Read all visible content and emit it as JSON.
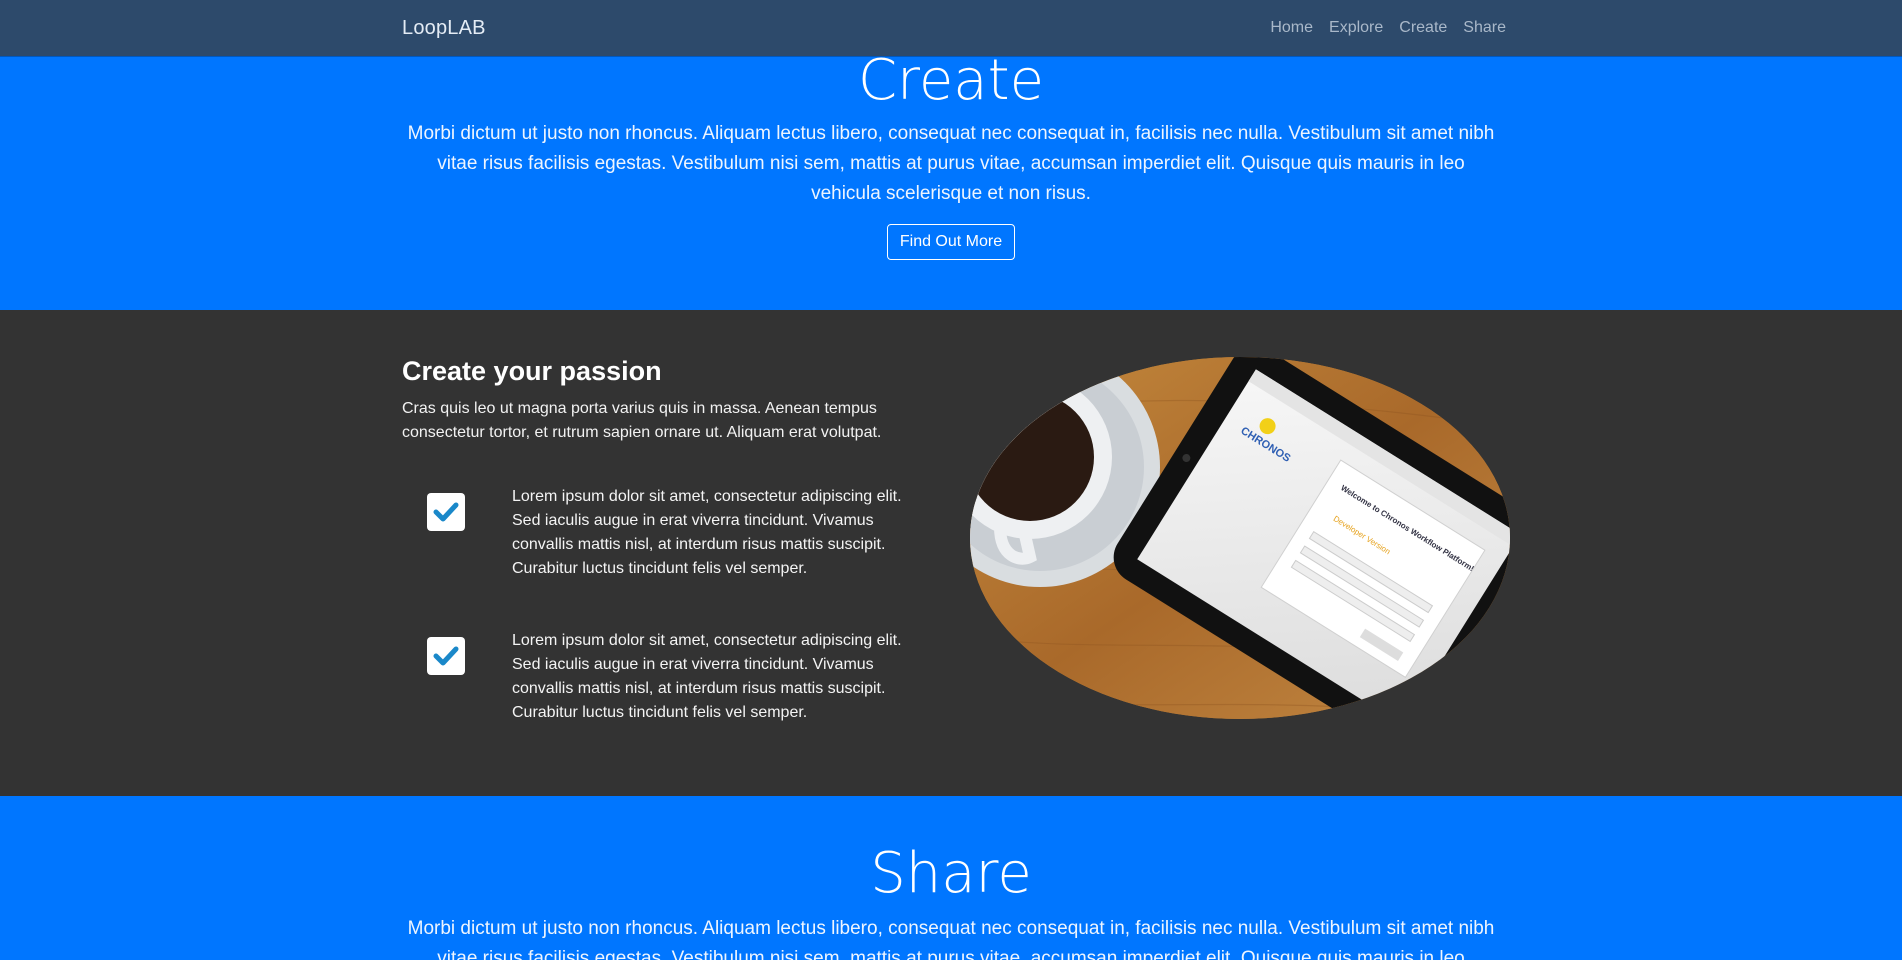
{
  "navbar": {
    "brand": "LoopLAB",
    "links": [
      "Home",
      "Explore",
      "Create",
      "Share"
    ]
  },
  "create_hero": {
    "title": "Create",
    "text": "Morbi dictum ut justo non rhoncus. Aliquam lectus libero, consequat nec consequat in, facilisis nec nulla. Vestibulum sit amet nibh vitae risus facilisis egestas. Vestibulum nisi sem, mattis at purus vitae, accumsan imperdiet elit. Quisque quis mauris in leo vehicula scelerisque et non risus.",
    "button_label": "Find Out More"
  },
  "passion": {
    "title": "Create your passion",
    "text": "Cras quis leo ut magna porta varius quis in massa. Aenean tempus consectetur tortor, et rutrum sapien ornare ut. Aliquam erat volutpat.",
    "features": [
      {
        "icon": "checkbox-checked-icon",
        "text": "Lorem ipsum dolor sit amet, consectetur adipiscing elit. Sed iaculis augue in erat viverra tincidunt. Vivamus convallis mattis nisl, at interdum risus mattis suscipit. Curabitur luctus tincidunt felis vel semper."
      },
      {
        "icon": "checkbox-checked-icon",
        "text": "Lorem ipsum dolor sit amet, consectetur adipiscing elit. Sed iaculis augue in erat viverra tincidunt. Vivamus convallis mattis nisl, at interdum risus mattis suscipit. Curabitur luctus tincidunt felis vel semper."
      }
    ],
    "image": {
      "logo_text": "CHRONOS",
      "screen_heading": "Welcome to Chronos Workflow Platform!",
      "screen_version": "Developer Version"
    }
  },
  "share_hero": {
    "title": "Share",
    "text": "Morbi dictum ut justo non rhoncus. Aliquam lectus libero, consequat nec consequat in, facilisis nec nulla. Vestibulum sit amet nibh vitae risus facilisis egestas. Vestibulum nisi sem, mattis at purus vitae, accumsan imperdiet elit. Quisque quis mauris in leo vehicula scelerisque et non risus."
  },
  "colors": {
    "navbar": "#2d4a6b",
    "primary_blue": "#0076ff",
    "dark_section": "#333333",
    "check_color": "#1a88c9"
  }
}
